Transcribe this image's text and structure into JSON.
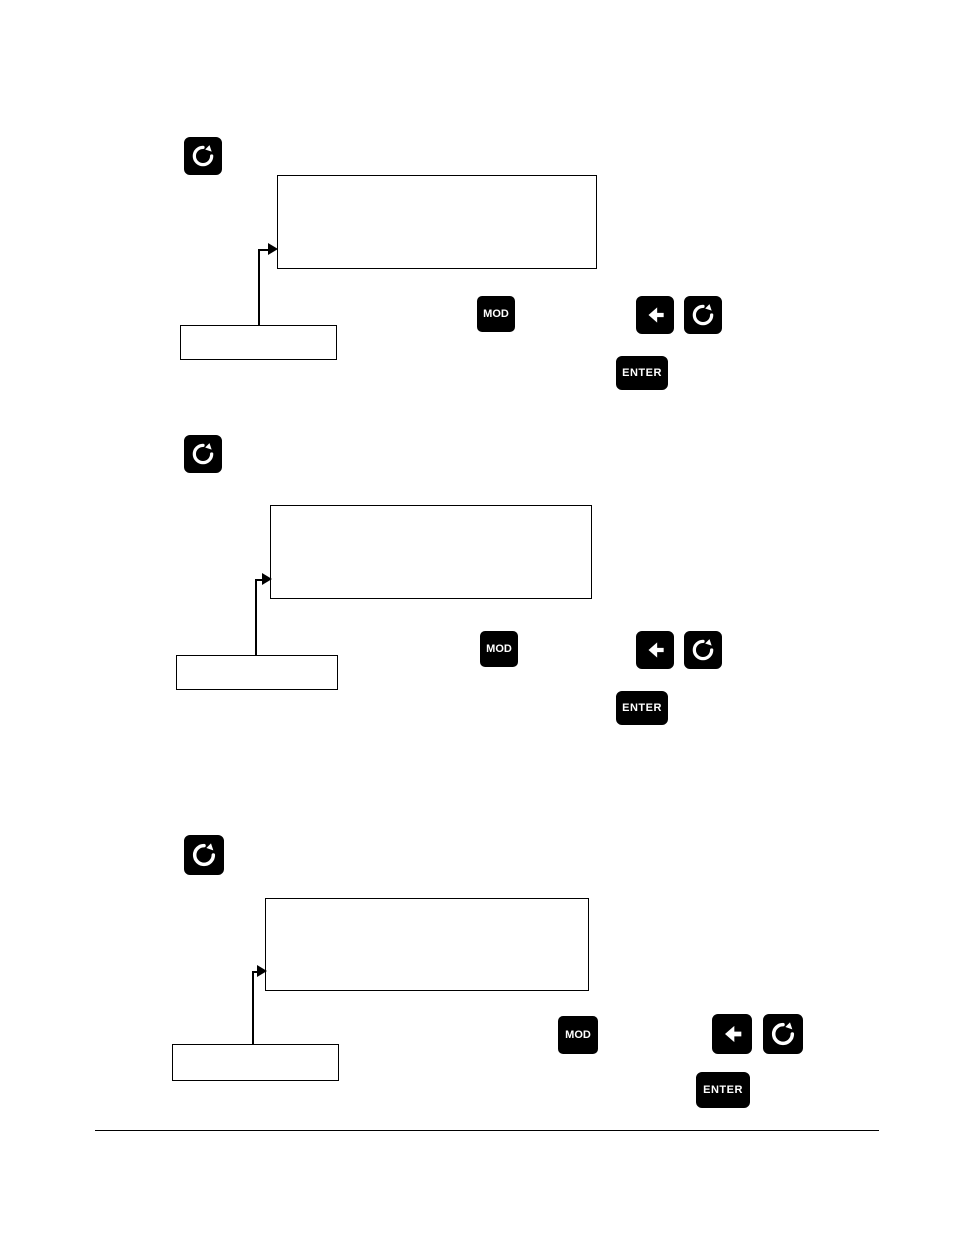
{
  "icons": {
    "cycle": "cycle-icon",
    "left_arrow": "left-arrow-icon",
    "mod": "MOD",
    "enter": "ENTER"
  },
  "buttons": {
    "mod_label": "MOD",
    "enter_label": "ENTER"
  }
}
